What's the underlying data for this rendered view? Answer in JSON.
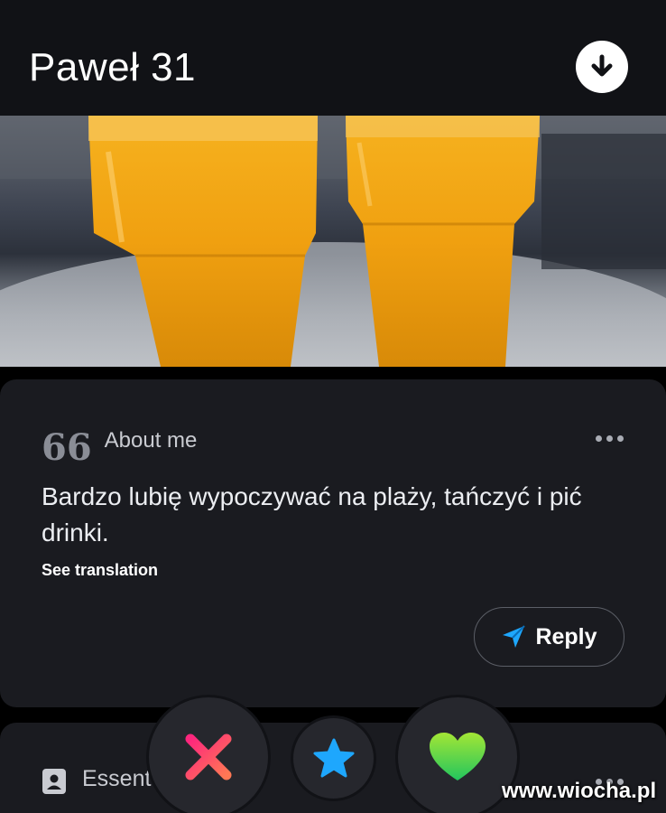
{
  "profile": {
    "name_age": "Paweł 31",
    "icons": {
      "down": "arrow-down-circle-icon"
    }
  },
  "about": {
    "icon": "quote-icon",
    "icon_glyph": "66",
    "title": "About me",
    "bio": "Bardzo lubię wypoczywać na plaży, tańczyć i pić drinki.",
    "see_translation": "See translation",
    "reply_label": "Reply",
    "reply_icon": "send-arrow-icon"
  },
  "essentials": {
    "icon": "id-badge-icon",
    "label": "Essent"
  },
  "actions": {
    "nope_icon": "x-icon",
    "super_like_icon": "star-icon",
    "like_icon": "heart-icon"
  },
  "watermark": "www.wiocha.pl",
  "colors": {
    "background": "#111216",
    "card": "#1a1b20",
    "nope_gradient": [
      "#fd267d",
      "#ff7854"
    ],
    "star": "#1ea7fd",
    "heart_gradient": [
      "#a3e635",
      "#22c55e"
    ]
  }
}
